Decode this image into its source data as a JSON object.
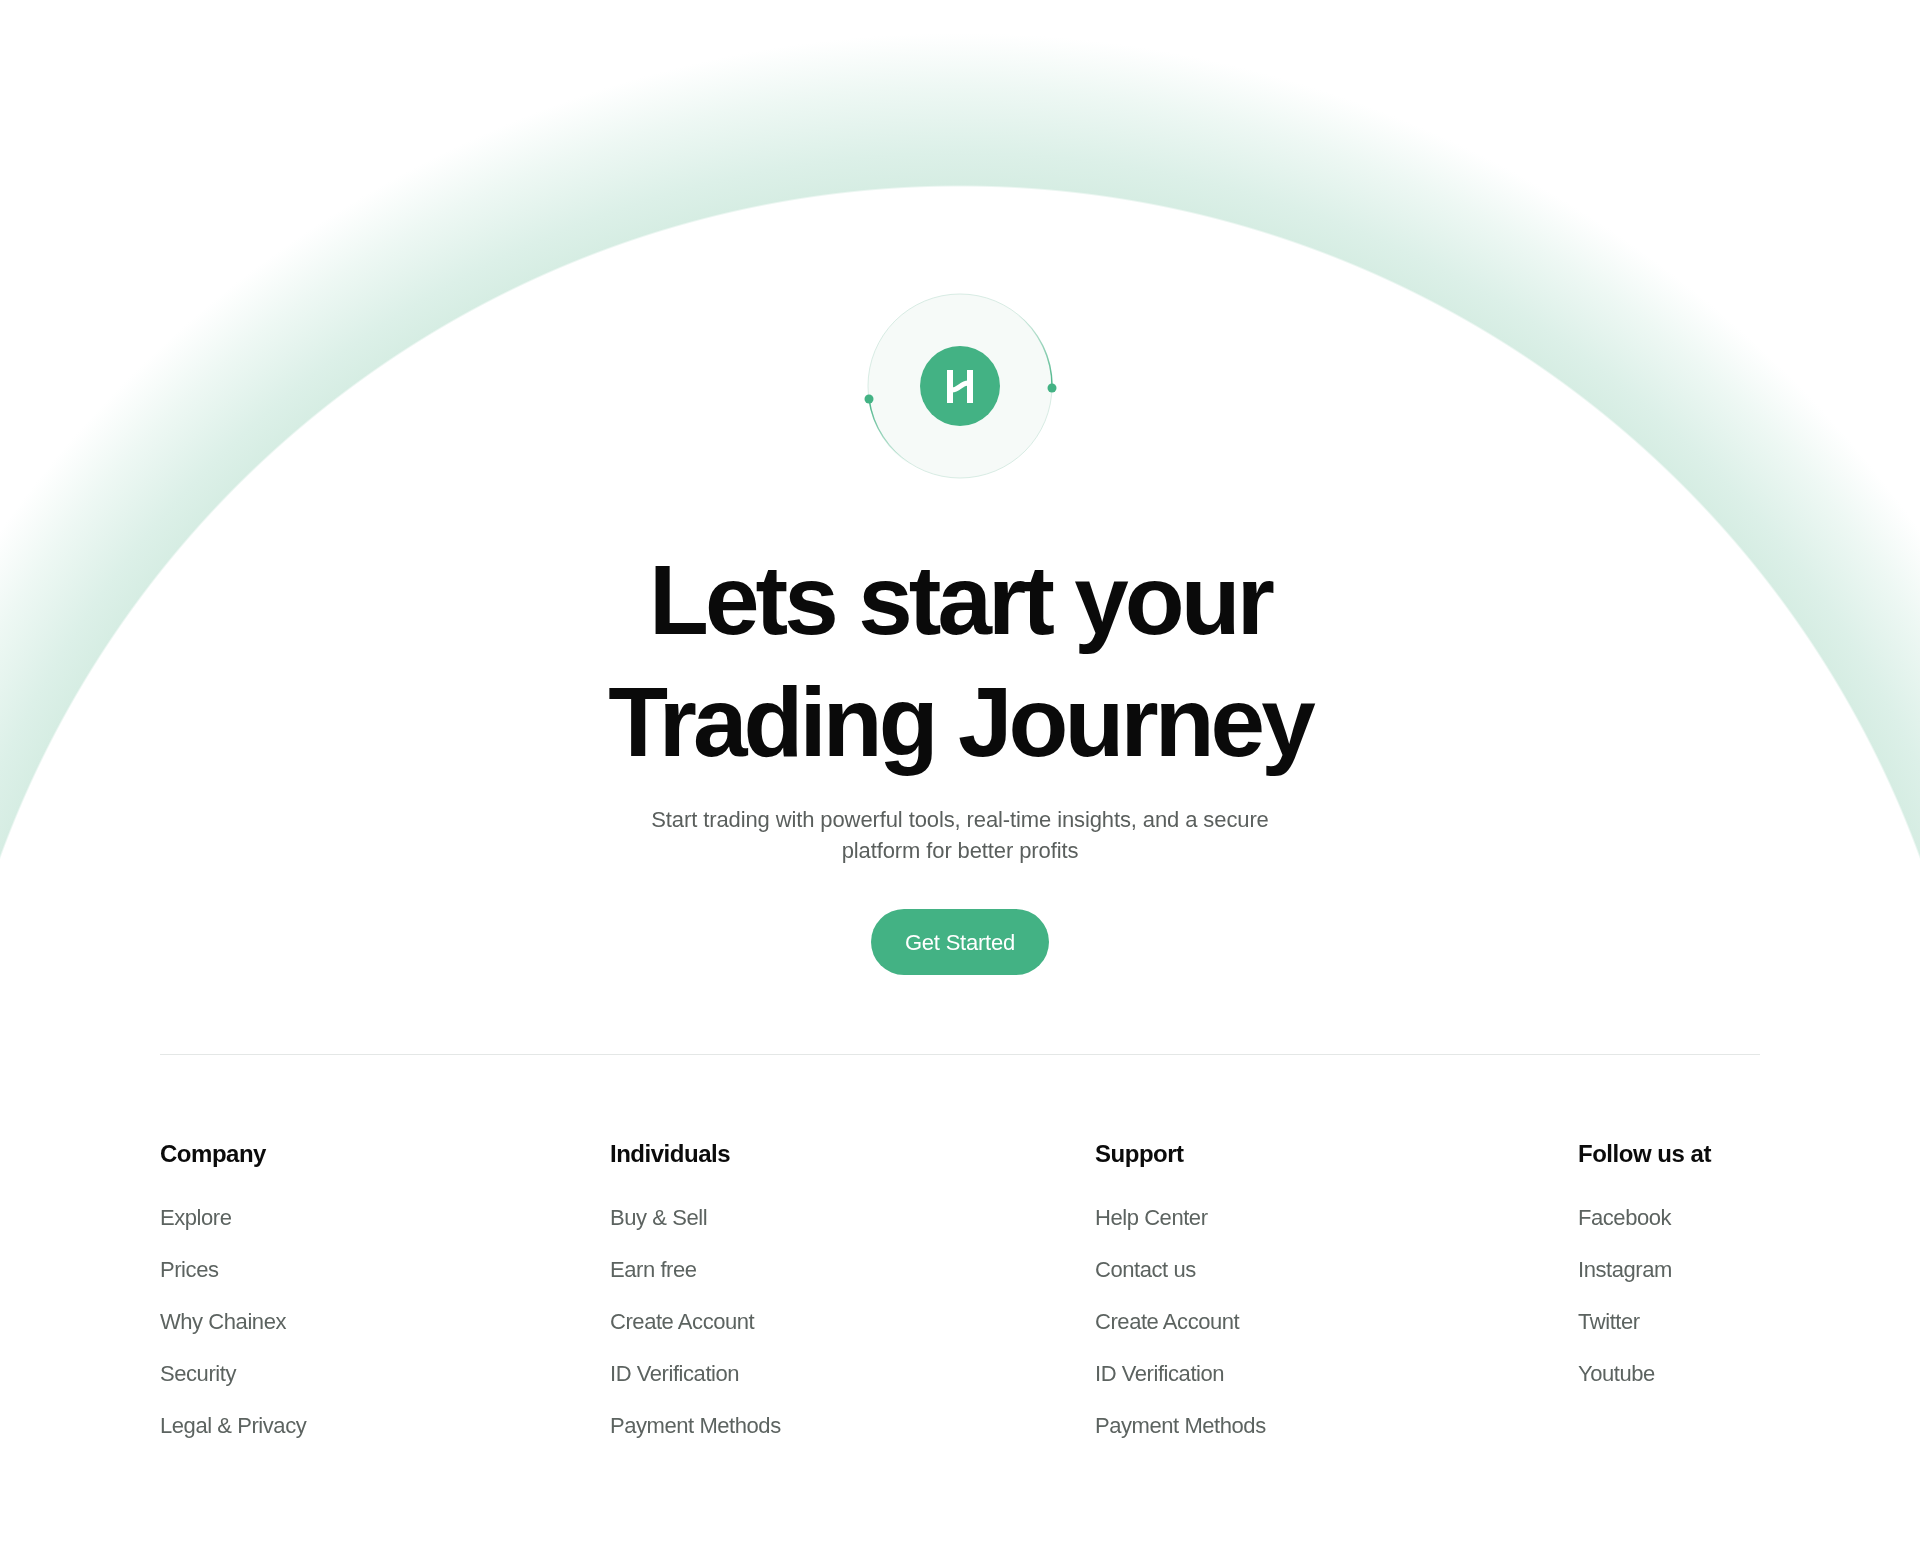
{
  "hero": {
    "title": "Lets start your Trading Journey",
    "subtitle": "Start trading with powerful tools, real-time insights, and a secure platform for better profits",
    "button": "Get Started"
  },
  "footer": {
    "columns": [
      {
        "heading": "Company",
        "links": [
          "Explore",
          "Prices",
          "Why Chainex",
          "Security",
          "Legal & Privacy"
        ]
      },
      {
        "heading": "Individuals",
        "links": [
          "Buy & Sell",
          "Earn free",
          "Create Account",
          "ID Verification",
          "Payment Methods"
        ]
      },
      {
        "heading": "Support",
        "links": [
          "Help Center",
          "Contact us",
          "Create Account",
          "ID Verification",
          "Payment Methods"
        ]
      },
      {
        "heading": "Follow us at",
        "links": [
          "Facebook",
          "Instagram",
          "Twitter",
          "Youtube"
        ]
      }
    ]
  }
}
